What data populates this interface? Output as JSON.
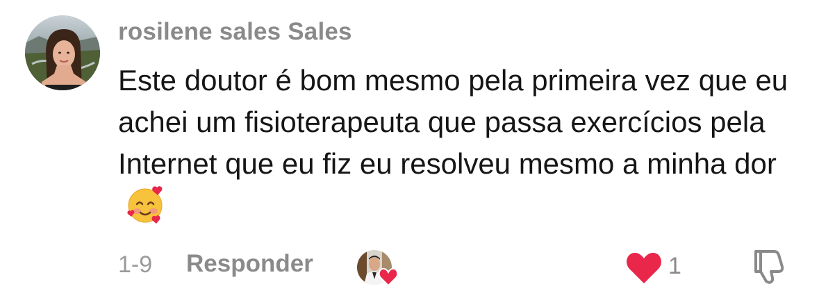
{
  "comment": {
    "username": "rosilene sales Sales",
    "text": "Este doutor é bom mesmo pela primeira vez que eu achei um fisioterapeuta que passa exercícios pela Internet que eu fiz eu resolveu mesmo a minha dor",
    "emoji_icon": "smiling-face-with-hearts-icon",
    "date": "1-9",
    "reply_label": "Responder",
    "like_count": "1",
    "liked": true,
    "liked_by_creator": true
  },
  "colors": {
    "username": "#8a8a8a",
    "text": "#161616",
    "meta": "#9a9a9a",
    "like_heart": "#e8274b"
  }
}
